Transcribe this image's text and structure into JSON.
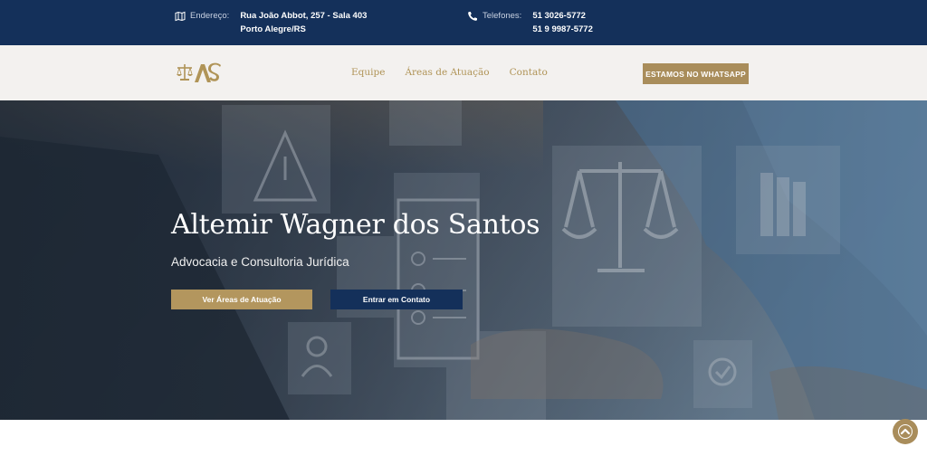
{
  "topbar": {
    "address_label": "Endereço:",
    "address_line1": "Rua João Abbot, 257 - Sala 403",
    "address_line2": "Porto Alegre/RS",
    "phone_label": "Telefones:",
    "phone1": "51 3026-5772",
    "phone2": "51 9 9987-5772",
    "icons": {
      "address": "map-icon",
      "phone": "phone-icon"
    }
  },
  "header": {
    "logo_icon": "scales-logo-icon",
    "nav": [
      "Equipe",
      "Áreas de Atuação",
      "Contato"
    ],
    "cta_label": "ESTAMOS NO WHATSAPP"
  },
  "hero": {
    "title": "Altemir Wagner dos Santos",
    "subtitle": "Advocacia e Consultoria Jurídica",
    "primary_button": "Ver Áreas de Atuação",
    "secondary_button": "Entrar em Contato"
  },
  "scroll_top_icon": "chevron-up-icon",
  "colors": {
    "navy": "#14305a",
    "gold": "#a98d5b",
    "nav_background": "#f3f1ef"
  }
}
